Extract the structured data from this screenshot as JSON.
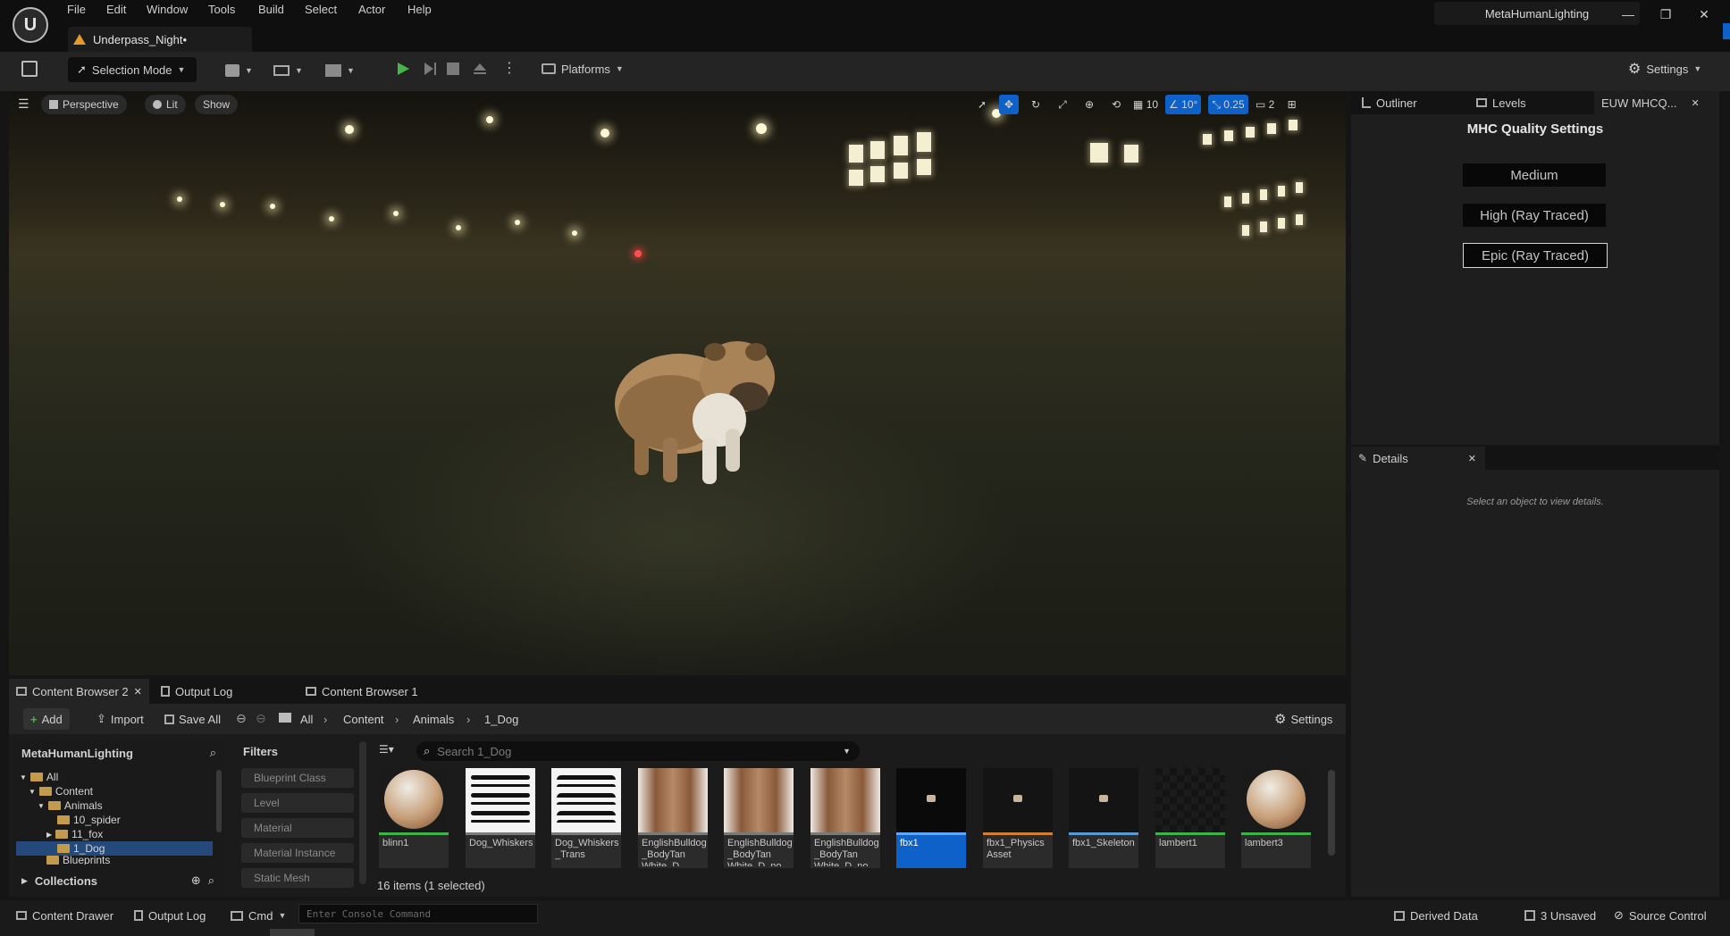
{
  "menu": [
    "File",
    "Edit",
    "Window",
    "Tools",
    "Build",
    "Select",
    "Actor",
    "Help"
  ],
  "document_tab": "Underpass_Night•",
  "project_name": "MetaHumanLighting",
  "toolbar": {
    "selection_mode": "Selection Mode",
    "platforms": "Platforms",
    "settings": "Settings"
  },
  "viewport": {
    "perspective": "Perspective",
    "lit": "Lit",
    "show": "Show",
    "grid_size": "10",
    "rotation_snap": "10°",
    "scale_snap": "0.25",
    "camera_speed": "2"
  },
  "right_tabs": [
    "Outliner",
    "Levels",
    "EUW MHCQ..."
  ],
  "mhc": {
    "title": "MHC Quality Settings",
    "options": [
      "Medium",
      "High (Ray Traced)",
      "Epic (Ray Traced)"
    ],
    "selected_index": 2
  },
  "details": {
    "tab": "Details",
    "message": "Select an object to view details."
  },
  "content_browser": {
    "tabs": [
      "Content Browser 2",
      "Output Log",
      "Content Browser 1"
    ],
    "add": "Add",
    "import": "Import",
    "save_all": "Save All",
    "breadcrumb": [
      "All",
      "Content",
      "Animals",
      "1_Dog"
    ],
    "settings": "Settings",
    "tree_title": "MetaHumanLighting",
    "tree": [
      "All",
      "Content",
      "Animals",
      "10_spider",
      "11_fox",
      "1_Dog",
      "Blueprints"
    ],
    "collections": "Collections",
    "filters_title": "Filters",
    "filters": [
      "Blueprint Class",
      "Level",
      "Material",
      "Material Instance",
      "Static Mesh"
    ],
    "search_placeholder": "Search 1_Dog",
    "assets": [
      {
        "name": "blinn1",
        "kind": "sphere",
        "bar": "#3fb24a"
      },
      {
        "name": "Dog_Whiskers",
        "kind": "whiskers",
        "bar": "#7a7a7a"
      },
      {
        "name": "Dog_Whiskers _Trans",
        "kind": "whiskers2",
        "bar": "#7a7a7a"
      },
      {
        "name": "EnglishBulldog _BodyTan White_D",
        "kind": "texture",
        "bar": "#7a7a7a"
      },
      {
        "name": "EnglishBulldog _BodyTan White_D_no",
        "kind": "texture",
        "bar": "#7a7a7a"
      },
      {
        "name": "EnglishBulldog _BodyTan White_D_no",
        "kind": "texture",
        "bar": "#7a7a7a"
      },
      {
        "name": "fbx1",
        "kind": "mesh",
        "bar": "#5aa8ff"
      },
      {
        "name": "fbx1_Physics Asset",
        "kind": "mesh",
        "bar": "#d08030"
      },
      {
        "name": "fbx1_Skeleton",
        "kind": "mesh",
        "bar": "#5a9ad0"
      },
      {
        "name": "lambert1",
        "kind": "dark",
        "bar": "#3fb24a"
      },
      {
        "name": "lambert3",
        "kind": "sphere",
        "bar": "#3fb24a"
      }
    ],
    "selected_asset": 6,
    "status": "16 items (1 selected)"
  },
  "statusbar": {
    "content_drawer": "Content Drawer",
    "output_log": "Output Log",
    "cmd": "Cmd",
    "console_placeholder": "Enter Console Command",
    "derived_data": "Derived Data",
    "unsaved": "3 Unsaved",
    "source_control": "Source Control"
  },
  "colors": {
    "accent": "#0d61c9",
    "play_green": "#47b648"
  }
}
